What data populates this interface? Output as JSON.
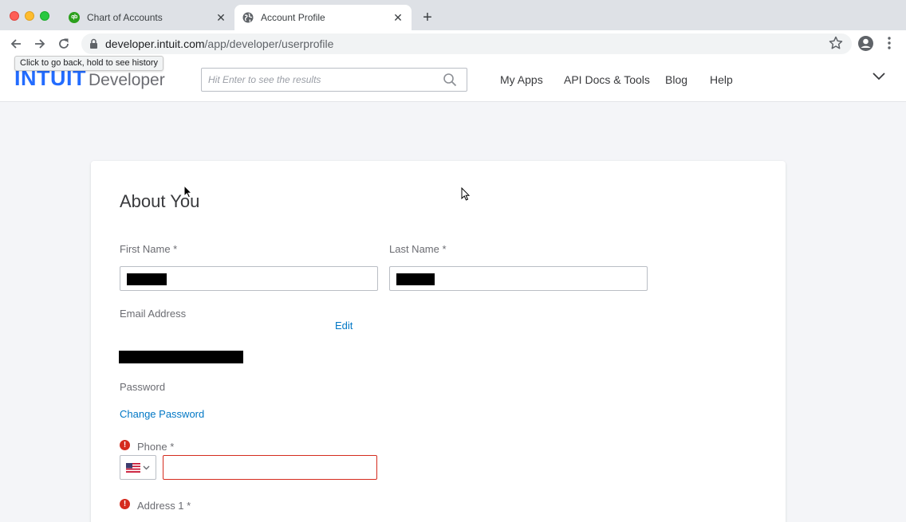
{
  "browser": {
    "tabs": [
      {
        "title": "Chart of Accounts",
        "icon": "quickbooks-icon",
        "active": false
      },
      {
        "title": "Account Profile",
        "icon": "globe-icon",
        "active": true
      }
    ],
    "url_host": "developer.intuit.com",
    "url_path": "/app/developer/userprofile",
    "back_tooltip": "Click to go back, hold to see history"
  },
  "header": {
    "logo_brand": "INTUIT",
    "logo_product": "Developer",
    "search_placeholder": "Hit Enter to see the results",
    "nav": [
      "My Apps",
      "API Docs & Tools",
      "Blog",
      "Help"
    ]
  },
  "form": {
    "title": "About You",
    "first_name_label": "First Name *",
    "last_name_label": "Last Name *",
    "email_label": "Email Address",
    "edit_link": "Edit",
    "password_label": "Password",
    "change_password_link": "Change Password",
    "phone_label": "Phone *",
    "address1_label": "Address 1 *"
  },
  "colors": {
    "brand_blue": "#236cff",
    "link_blue": "#0077c5",
    "error_red": "#d52b1e"
  }
}
